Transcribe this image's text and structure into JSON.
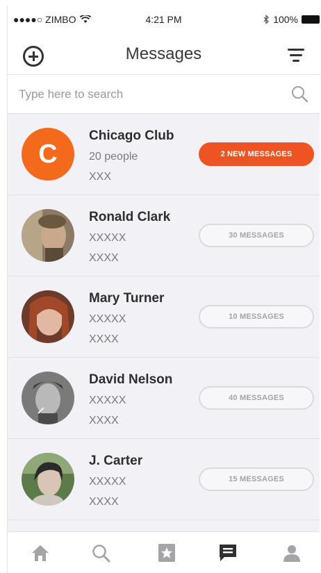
{
  "status_bar": {
    "carrier": "●●●●○ ZIMBO",
    "time": "4:21 PM",
    "battery": "100%"
  },
  "header": {
    "title": "Messages"
  },
  "search": {
    "placeholder": "Type here to search"
  },
  "conversations": [
    {
      "name": "Chicago Club",
      "line1": "20 people",
      "line2": "XXX",
      "badge": "2 NEW MESSAGES",
      "avatar_letter": "C",
      "unread": true
    },
    {
      "name": "Ronald Clark",
      "line1": "XXXXX",
      "line2": "XXXX",
      "badge": "30 MESSAGES",
      "unread": false
    },
    {
      "name": "Mary Turner",
      "line1": "XXXXX",
      "line2": "XXXX",
      "badge": "10 MESSAGES",
      "unread": false
    },
    {
      "name": "David Nelson",
      "line1": "XXXXX",
      "line2": "XXXX",
      "badge": "40 MESSAGES",
      "unread": false
    },
    {
      "name": "J. Carter",
      "line1": "XXXXX",
      "line2": "XXXX",
      "badge": "15 MESSAGES",
      "unread": false
    }
  ],
  "tab_bar": {
    "tabs": [
      "home-icon",
      "search-icon",
      "favorites-icon",
      "messages-icon",
      "profile-icon"
    ],
    "active": "messages-icon"
  },
  "colors": {
    "accent": "#ee5322",
    "avatar_orange": "#f36a1d"
  }
}
